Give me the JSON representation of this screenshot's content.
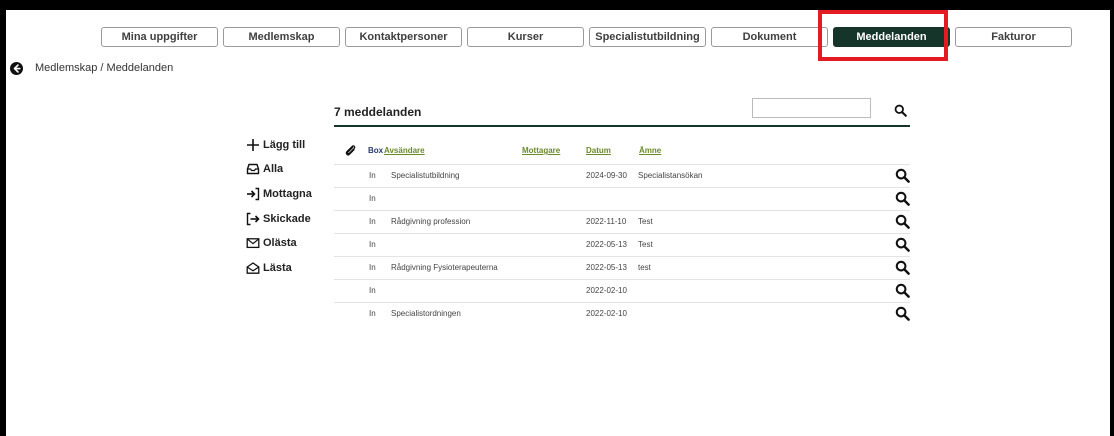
{
  "tabs": [
    {
      "label": "Mina uppgifter",
      "active": false
    },
    {
      "label": "Medlemskap",
      "active": false
    },
    {
      "label": "Kontaktpersoner",
      "active": false
    },
    {
      "label": "Kurser",
      "active": false
    },
    {
      "label": "Specialistutbildning",
      "active": false
    },
    {
      "label": "Dokument",
      "active": false
    },
    {
      "label": "Meddelanden",
      "active": true
    },
    {
      "label": "Fakturor",
      "active": false
    }
  ],
  "breadcrumb": "Medlemskap / Meddelanden",
  "sidebar": {
    "items": [
      {
        "label": "Lägg till",
        "icon": "plus-icon"
      },
      {
        "label": "Alla",
        "icon": "inbox-icon"
      },
      {
        "label": "Mottagna",
        "icon": "sign-in-icon"
      },
      {
        "label": "Skickade",
        "icon": "sign-out-icon"
      },
      {
        "label": "Olästa",
        "icon": "envelope-icon"
      },
      {
        "label": "Lästa",
        "icon": "envelope-open-icon"
      }
    ]
  },
  "list": {
    "title": "7 meddelanden",
    "search_value": "",
    "columns": {
      "box": "Box",
      "sender": "Avsändare",
      "recipient": "Mottagare",
      "date": "Datum",
      "subject": "Ämne"
    },
    "rows": [
      {
        "box": "In",
        "sender": "Specialistutbildning",
        "recipient": "",
        "date": "2024-09-30",
        "subject": "Specialistansökan"
      },
      {
        "box": "In",
        "sender": "",
        "recipient": "",
        "date": "",
        "subject": ""
      },
      {
        "box": "In",
        "sender": "Rådgivning profession",
        "recipient": "",
        "date": "2022-11-10",
        "subject": "Test"
      },
      {
        "box": "In",
        "sender": "",
        "recipient": "",
        "date": "2022-05-13",
        "subject": "Test"
      },
      {
        "box": "In",
        "sender": "Rådgivning Fysioterapeuterna",
        "recipient": "",
        "date": "2022-05-13",
        "subject": "test"
      },
      {
        "box": "In",
        "sender": "",
        "recipient": "",
        "date": "2022-02-10",
        "subject": ""
      },
      {
        "box": "In",
        "sender": "Specialistordningen",
        "recipient": "",
        "date": "2022-02-10",
        "subject": ""
      }
    ]
  },
  "colors": {
    "accent": "#16352a",
    "highlight": "#e51b24",
    "link": "#6b8a2a"
  }
}
